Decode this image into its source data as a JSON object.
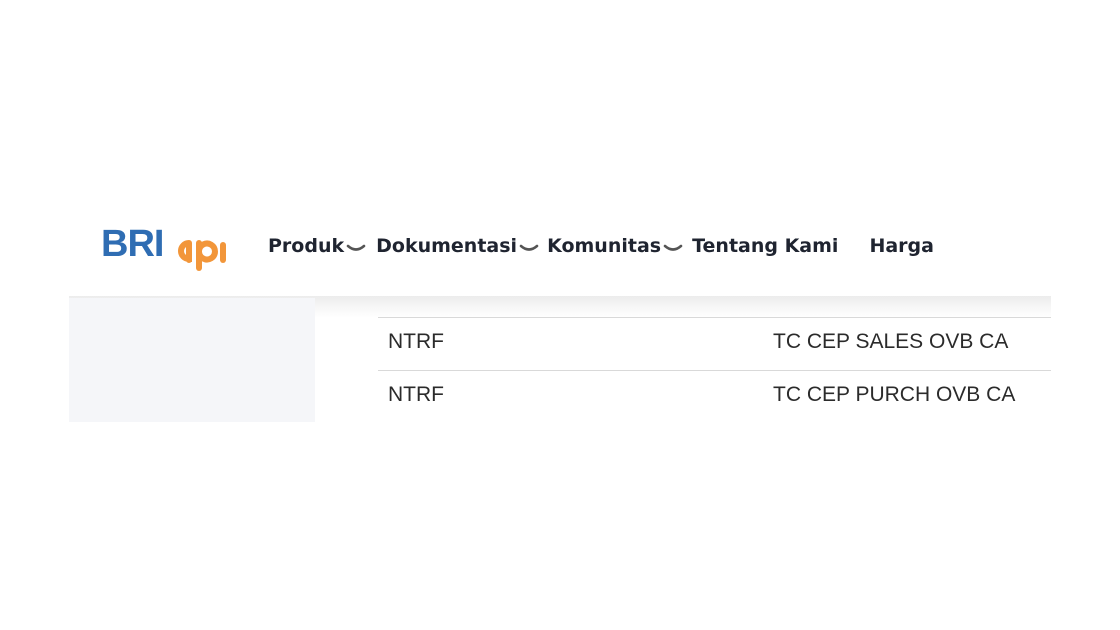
{
  "brand": {
    "logo_primary": "BRI",
    "logo_secondary": "api",
    "colors": {
      "blue": "#2f6db3",
      "orange": "#f2963a"
    }
  },
  "nav": {
    "items": [
      {
        "label": "Produk",
        "has_dropdown": true
      },
      {
        "label": "Dokumentasi",
        "has_dropdown": true
      },
      {
        "label": "Komunitas",
        "has_dropdown": true
      },
      {
        "label": "Tentang Kami",
        "has_dropdown": false
      },
      {
        "label": "Harga",
        "has_dropdown": false
      }
    ],
    "dropdown_icon": "chevron-down-icon"
  },
  "table": {
    "rows": [
      {
        "code": "NTRF",
        "description": "TC CEP SALES OVB CA"
      },
      {
        "code": "NTRF",
        "description": "TC CEP PURCH OVB CA"
      }
    ]
  }
}
